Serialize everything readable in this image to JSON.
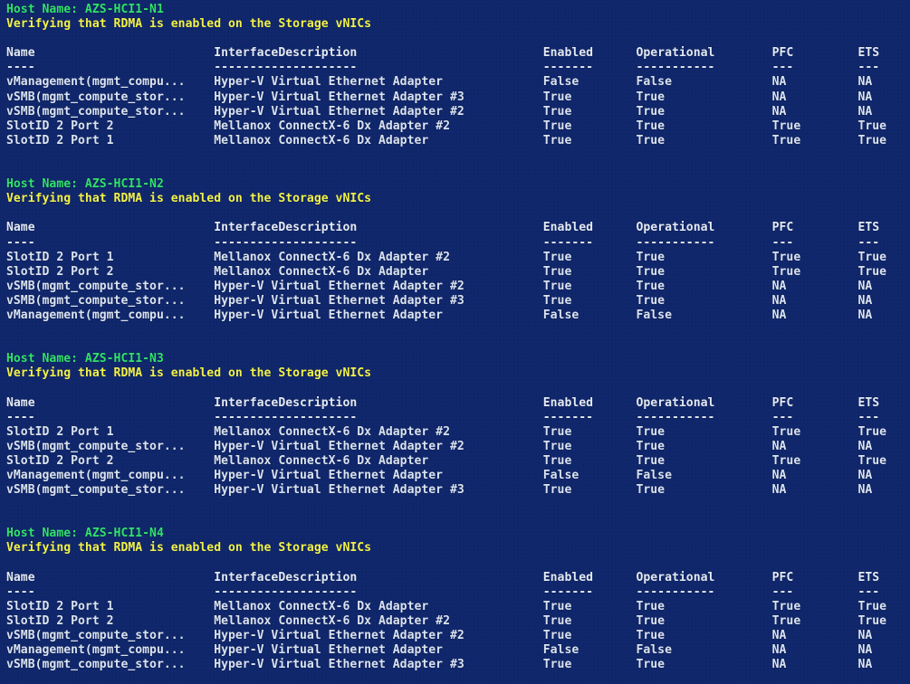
{
  "console": {
    "background_color": "#10266b",
    "text_color": "#dfe7f2",
    "host_line_color": "#31e36a",
    "verify_line_color": "#f2f24a",
    "columns": {
      "name": "Name",
      "interface_description": "InterfaceDescription",
      "enabled": "Enabled",
      "operational": "Operational",
      "pfc": "PFC",
      "ets": "ETS"
    },
    "rules": {
      "name": "----",
      "interface_description": "--------------------",
      "enabled": "-------",
      "operational": "-----------",
      "pfc": "---",
      "ets": "---"
    },
    "verify_message": "Verifying that RDMA is enabled on the Storage vNICs",
    "host_label": "Host Name: ",
    "blocks": [
      {
        "host_name": "AZS-HCI1-N1",
        "host_line": "Host Name: AZS-HCI1-N1",
        "verify_line": "Verifying that RDMA is enabled on the Storage vNICs",
        "rows": [
          {
            "name": "vManagement(mgmt_compu...",
            "interface_description": "Hyper-V Virtual Ethernet Adapter",
            "enabled": "False",
            "operational": "False",
            "pfc": "NA",
            "ets": "NA"
          },
          {
            "name": "vSMB(mgmt_compute_stor...",
            "interface_description": "Hyper-V Virtual Ethernet Adapter #3",
            "enabled": "True",
            "operational": "True",
            "pfc": "NA",
            "ets": "NA"
          },
          {
            "name": "vSMB(mgmt_compute_stor...",
            "interface_description": "Hyper-V Virtual Ethernet Adapter #2",
            "enabled": "True",
            "operational": "True",
            "pfc": "NA",
            "ets": "NA"
          },
          {
            "name": "SlotID 2 Port 2",
            "interface_description": "Mellanox ConnectX-6 Dx Adapter #2",
            "enabled": "True",
            "operational": "True",
            "pfc": "True",
            "ets": "True"
          },
          {
            "name": "SlotID 2 Port 1",
            "interface_description": "Mellanox ConnectX-6 Dx Adapter",
            "enabled": "True",
            "operational": "True",
            "pfc": "True",
            "ets": "True"
          }
        ]
      },
      {
        "host_name": "AZS-HCI1-N2",
        "host_line": "Host Name: AZS-HCI1-N2",
        "verify_line": "Verifying that RDMA is enabled on the Storage vNICs",
        "rows": [
          {
            "name": "SlotID 2 Port 1",
            "interface_description": "Mellanox ConnectX-6 Dx Adapter #2",
            "enabled": "True",
            "operational": "True",
            "pfc": "True",
            "ets": "True"
          },
          {
            "name": "SlotID 2 Port 2",
            "interface_description": "Mellanox ConnectX-6 Dx Adapter",
            "enabled": "True",
            "operational": "True",
            "pfc": "True",
            "ets": "True"
          },
          {
            "name": "vSMB(mgmt_compute_stor...",
            "interface_description": "Hyper-V Virtual Ethernet Adapter #2",
            "enabled": "True",
            "operational": "True",
            "pfc": "NA",
            "ets": "NA"
          },
          {
            "name": "vSMB(mgmt_compute_stor...",
            "interface_description": "Hyper-V Virtual Ethernet Adapter #3",
            "enabled": "True",
            "operational": "True",
            "pfc": "NA",
            "ets": "NA"
          },
          {
            "name": "vManagement(mgmt_compu...",
            "interface_description": "Hyper-V Virtual Ethernet Adapter",
            "enabled": "False",
            "operational": "False",
            "pfc": "NA",
            "ets": "NA"
          }
        ]
      },
      {
        "host_name": "AZS-HCI1-N3",
        "host_line": "Host Name: AZS-HCI1-N3",
        "verify_line": "Verifying that RDMA is enabled on the Storage vNICs",
        "rows": [
          {
            "name": "SlotID 2 Port 1",
            "interface_description": "Mellanox ConnectX-6 Dx Adapter #2",
            "enabled": "True",
            "operational": "True",
            "pfc": "True",
            "ets": "True"
          },
          {
            "name": "vSMB(mgmt_compute_stor...",
            "interface_description": "Hyper-V Virtual Ethernet Adapter #2",
            "enabled": "True",
            "operational": "True",
            "pfc": "NA",
            "ets": "NA"
          },
          {
            "name": "SlotID 2 Port 2",
            "interface_description": "Mellanox ConnectX-6 Dx Adapter",
            "enabled": "True",
            "operational": "True",
            "pfc": "True",
            "ets": "True"
          },
          {
            "name": "vManagement(mgmt_compu...",
            "interface_description": "Hyper-V Virtual Ethernet Adapter",
            "enabled": "False",
            "operational": "False",
            "pfc": "NA",
            "ets": "NA"
          },
          {
            "name": "vSMB(mgmt_compute_stor...",
            "interface_description": "Hyper-V Virtual Ethernet Adapter #3",
            "enabled": "True",
            "operational": "True",
            "pfc": "NA",
            "ets": "NA"
          }
        ]
      },
      {
        "host_name": "AZS-HCI1-N4",
        "host_line": "Host Name: AZS-HCI1-N4",
        "verify_line": "Verifying that RDMA is enabled on the Storage vNICs",
        "rows": [
          {
            "name": "SlotID 2 Port 1",
            "interface_description": "Mellanox ConnectX-6 Dx Adapter",
            "enabled": "True",
            "operational": "True",
            "pfc": "True",
            "ets": "True"
          },
          {
            "name": "SlotID 2 Port 2",
            "interface_description": "Mellanox ConnectX-6 Dx Adapter #2",
            "enabled": "True",
            "operational": "True",
            "pfc": "True",
            "ets": "True"
          },
          {
            "name": "vSMB(mgmt_compute_stor...",
            "interface_description": "Hyper-V Virtual Ethernet Adapter #2",
            "enabled": "True",
            "operational": "True",
            "pfc": "NA",
            "ets": "NA"
          },
          {
            "name": "vManagement(mgmt_compu...",
            "interface_description": "Hyper-V Virtual Ethernet Adapter",
            "enabled": "False",
            "operational": "False",
            "pfc": "NA",
            "ets": "NA"
          },
          {
            "name": "vSMB(mgmt_compute_stor...",
            "interface_description": "Hyper-V Virtual Ethernet Adapter #3",
            "enabled": "True",
            "operational": "True",
            "pfc": "NA",
            "ets": "NA"
          }
        ]
      }
    ]
  }
}
